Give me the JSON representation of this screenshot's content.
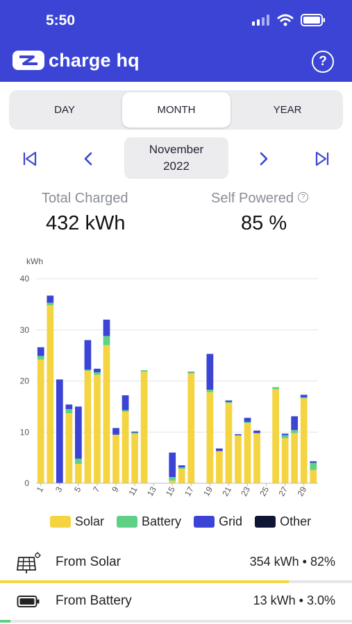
{
  "status_bar": {
    "time": "5:50"
  },
  "header": {
    "brand": "charge hq",
    "help_label": "?"
  },
  "tabs": [
    {
      "label": "DAY",
      "active": false
    },
    {
      "label": "MONTH",
      "active": true
    },
    {
      "label": "YEAR",
      "active": false
    }
  ],
  "period": {
    "month": "November",
    "year": "2022"
  },
  "stats": {
    "total_label": "Total Charged",
    "total_value": "432 kWh",
    "self_label": "Self Powered",
    "self_value": "85 %"
  },
  "colors": {
    "solar": "#f5d442",
    "battery": "#5fd186",
    "grid": "#3b44d4",
    "other": "#0f1633",
    "brand": "#3b44d4"
  },
  "chart_data": {
    "type": "bar",
    "stacked": true,
    "ylabel": "kWh",
    "ylim": [
      0,
      40
    ],
    "yticks": [
      0,
      10,
      20,
      30,
      40
    ],
    "x": [
      1,
      2,
      3,
      4,
      5,
      6,
      7,
      8,
      9,
      10,
      11,
      12,
      13,
      14,
      15,
      16,
      17,
      18,
      19,
      20,
      21,
      22,
      23,
      24,
      25,
      26,
      27,
      28,
      29,
      30
    ],
    "xtick_labels": [
      "1",
      "3",
      "5",
      "7",
      "9",
      "11",
      "13",
      "15",
      "17",
      "19",
      "21",
      "23",
      "25",
      "27",
      "29"
    ],
    "series": [
      {
        "name": "Solar",
        "values": [
          24.2,
          34.8,
          0,
          13.7,
          3.8,
          22.0,
          21.2,
          27.0,
          9.5,
          14.0,
          9.7,
          21.8,
          0,
          0,
          0.5,
          2.8,
          21.5,
          0,
          17.8,
          6.3,
          15.7,
          9.3,
          11.8,
          9.8,
          0,
          18.4,
          8.8,
          9.8,
          16.6,
          2.6
        ]
      },
      {
        "name": "Battery",
        "values": [
          0.7,
          0.5,
          0,
          0.8,
          1.0,
          0.2,
          0.5,
          1.8,
          0,
          0.3,
          0.2,
          0.3,
          0,
          0,
          0.7,
          0.3,
          0.2,
          0,
          0.5,
          0,
          0.2,
          0.1,
          0.2,
          0,
          0,
          0.4,
          0.6,
          0.6,
          0.2,
          1.4
        ]
      },
      {
        "name": "Grid",
        "values": [
          1.7,
          1.4,
          20.3,
          0.9,
          10.2,
          5.8,
          0.7,
          3.2,
          1.3,
          2.9,
          0.2,
          0,
          0,
          0,
          4.8,
          0.4,
          0.1,
          0,
          7.0,
          0.5,
          0.3,
          0.2,
          0.8,
          0.5,
          0,
          0,
          0.3,
          2.7,
          0.5,
          0.3
        ]
      },
      {
        "name": "Other",
        "values": [
          0,
          0,
          0,
          0,
          0,
          0,
          0,
          0,
          0,
          0,
          0,
          0,
          0,
          0,
          0,
          0,
          0,
          0,
          0,
          0,
          0,
          0,
          0,
          0,
          0,
          0,
          0,
          0,
          0,
          0
        ]
      }
    ],
    "legend_position": "bottom",
    "grid": true
  },
  "sources": [
    {
      "label": "From Solar",
      "value": "354 kWh • 82%",
      "progress": 0.82,
      "icon": "solar-panel-icon"
    },
    {
      "label": "From Battery",
      "value": "13 kWh • 3.0%",
      "progress": 0.03,
      "icon": "battery-icon"
    }
  ]
}
